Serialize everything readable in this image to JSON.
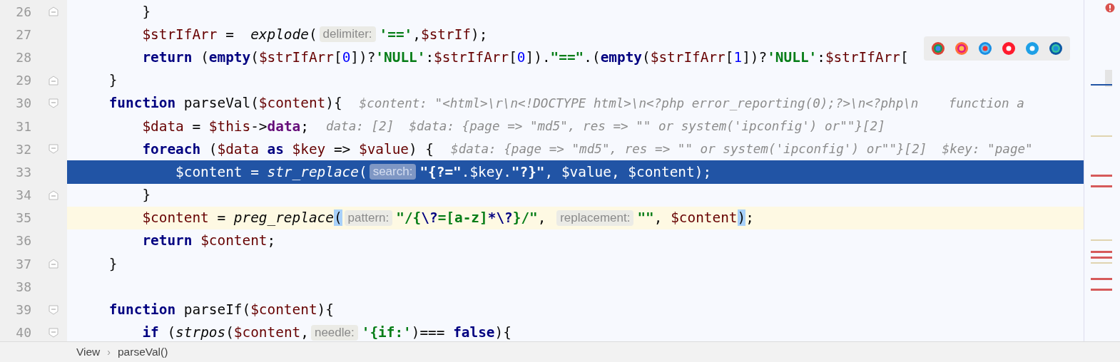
{
  "editor": {
    "lines": [
      {
        "number": "26",
        "kind": "fold-end",
        "selected": false,
        "current": false,
        "tokens": [
          {
            "kind": "plain",
            "text": "        }"
          }
        ]
      },
      {
        "number": "27",
        "kind": "plain",
        "selected": false,
        "current": false,
        "tokens": [
          {
            "kind": "var",
            "text": "        $strIfArr"
          },
          {
            "kind": "plain",
            "text": " =  "
          },
          {
            "kind": "fn",
            "text": "explode"
          },
          {
            "kind": "plain",
            "text": "("
          },
          {
            "kind": "hint",
            "text": "delimiter:"
          },
          {
            "kind": "str",
            "text": "'=='"
          },
          {
            "kind": "plain",
            "text": ","
          },
          {
            "kind": "var",
            "text": "$strIf"
          },
          {
            "kind": "plain",
            "text": ");"
          }
        ]
      },
      {
        "number": "28",
        "kind": "plain",
        "selected": false,
        "current": false,
        "tokens": [
          {
            "kind": "kw",
            "text": "        return"
          },
          {
            "kind": "plain",
            "text": " ("
          },
          {
            "kind": "kw",
            "text": "empty"
          },
          {
            "kind": "plain",
            "text": "("
          },
          {
            "kind": "var",
            "text": "$strIfArr"
          },
          {
            "kind": "plain",
            "text": "["
          },
          {
            "kind": "num",
            "text": "0"
          },
          {
            "kind": "plain",
            "text": "])?"
          },
          {
            "kind": "str",
            "text": "'NULL'"
          },
          {
            "kind": "plain",
            "text": ":"
          },
          {
            "kind": "var",
            "text": "$strIfArr"
          },
          {
            "kind": "plain",
            "text": "["
          },
          {
            "kind": "num",
            "text": "0"
          },
          {
            "kind": "plain",
            "text": "])."
          },
          {
            "kind": "str",
            "text": "\"==\""
          },
          {
            "kind": "plain",
            "text": ".("
          },
          {
            "kind": "kw",
            "text": "empty"
          },
          {
            "kind": "plain",
            "text": "("
          },
          {
            "kind": "var",
            "text": "$strIfArr"
          },
          {
            "kind": "plain",
            "text": "["
          },
          {
            "kind": "num",
            "text": "1"
          },
          {
            "kind": "plain",
            "text": "])?"
          },
          {
            "kind": "str",
            "text": "'NULL'"
          },
          {
            "kind": "plain",
            "text": ":"
          },
          {
            "kind": "var",
            "text": "$strIfArr"
          },
          {
            "kind": "plain",
            "text": "["
          }
        ]
      },
      {
        "number": "29",
        "kind": "fold-end",
        "selected": false,
        "current": false,
        "tokens": [
          {
            "kind": "plain",
            "text": "    }"
          }
        ]
      },
      {
        "number": "30",
        "kind": "fold-start",
        "selected": false,
        "current": false,
        "tokens": [
          {
            "kind": "kw",
            "text": "    function"
          },
          {
            "kind": "plain",
            "text": " parseVal("
          },
          {
            "kind": "var",
            "text": "$content"
          },
          {
            "kind": "plain",
            "text": "){"
          },
          {
            "kind": "debug",
            "text": "$content: \"<html>\\r\\n<!DOCTYPE html>\\n<?php error_reporting(0);?>\\n<?php\\n    function a"
          }
        ]
      },
      {
        "number": "31",
        "kind": "plain",
        "selected": false,
        "current": false,
        "tokens": [
          {
            "kind": "var",
            "text": "        $data"
          },
          {
            "kind": "plain",
            "text": " = "
          },
          {
            "kind": "var",
            "text": "$this"
          },
          {
            "kind": "plain",
            "text": "->"
          },
          {
            "kind": "field",
            "text": "data"
          },
          {
            "kind": "plain",
            "text": ";"
          },
          {
            "kind": "debug",
            "text": "data: [2]  $data: {page => \"md5\", res => \"\" or system('ipconfig') or\"\"}[2]"
          }
        ]
      },
      {
        "number": "32",
        "kind": "fold-start",
        "selected": false,
        "current": false,
        "tokens": [
          {
            "kind": "kw",
            "text": "        foreach"
          },
          {
            "kind": "plain",
            "text": " ("
          },
          {
            "kind": "var",
            "text": "$data"
          },
          {
            "kind": "kw",
            "text": " as "
          },
          {
            "kind": "var",
            "text": "$key"
          },
          {
            "kind": "plain",
            "text": " => "
          },
          {
            "kind": "var",
            "text": "$value"
          },
          {
            "kind": "plain",
            "text": ") {"
          },
          {
            "kind": "debug",
            "text": "$data: {page => \"md5\", res => \"\" or system('ipconfig') or\"\"}[2]  $key: \"page\""
          }
        ]
      },
      {
        "number": "33",
        "kind": "plain",
        "selected": true,
        "current": false,
        "tokens": [
          {
            "kind": "var",
            "text": "            $content"
          },
          {
            "kind": "plain",
            "text": " = "
          },
          {
            "kind": "fn",
            "text": "str_replace"
          },
          {
            "kind": "plain",
            "text": "("
          },
          {
            "kind": "hint",
            "text": "search:"
          },
          {
            "kind": "str",
            "text": "\"{?=\""
          },
          {
            "kind": "plain",
            "text": "."
          },
          {
            "kind": "var",
            "text": "$key"
          },
          {
            "kind": "plain",
            "text": "."
          },
          {
            "kind": "str",
            "text": "\"?}\""
          },
          {
            "kind": "plain",
            "text": ", "
          },
          {
            "kind": "var",
            "text": "$value"
          },
          {
            "kind": "plain",
            "text": ", "
          },
          {
            "kind": "var",
            "text": "$content"
          },
          {
            "kind": "plain",
            "text": ");"
          }
        ]
      },
      {
        "number": "34",
        "kind": "fold-end",
        "selected": false,
        "current": false,
        "tokens": [
          {
            "kind": "plain",
            "text": "        }"
          }
        ]
      },
      {
        "number": "35",
        "kind": "plain",
        "selected": false,
        "current": true,
        "tokens": [
          {
            "kind": "var",
            "text": "        $content"
          },
          {
            "kind": "plain",
            "text": " = "
          },
          {
            "kind": "fn",
            "text": "preg_replace"
          },
          {
            "kind": "match",
            "text": "("
          },
          {
            "kind": "hint",
            "text": "pattern:"
          },
          {
            "kind": "str",
            "text": "\"/{"
          },
          {
            "kind": "esc",
            "text": "\\?"
          },
          {
            "kind": "str",
            "text": "=[a-z]"
          },
          {
            "kind": "esc",
            "text": "*\\?"
          },
          {
            "kind": "str",
            "text": "}/\""
          },
          {
            "kind": "plain",
            "text": ", "
          },
          {
            "kind": "hint",
            "text": "replacement:"
          },
          {
            "kind": "str",
            "text": "\"\""
          },
          {
            "kind": "plain",
            "text": ", "
          },
          {
            "kind": "var",
            "text": "$content"
          },
          {
            "kind": "match",
            "text": ")"
          },
          {
            "kind": "plain",
            "text": ";"
          }
        ]
      },
      {
        "number": "36",
        "kind": "plain",
        "selected": false,
        "current": false,
        "tokens": [
          {
            "kind": "kw",
            "text": "        return"
          },
          {
            "kind": "var",
            "text": " $content"
          },
          {
            "kind": "plain",
            "text": ";"
          }
        ]
      },
      {
        "number": "37",
        "kind": "fold-end",
        "selected": false,
        "current": false,
        "tokens": [
          {
            "kind": "plain",
            "text": "    }"
          }
        ]
      },
      {
        "number": "38",
        "kind": "plain",
        "selected": false,
        "current": false
      },
      {
        "number": "39",
        "kind": "fold-start",
        "selected": false,
        "current": false,
        "tokens": [
          {
            "kind": "kw",
            "text": "    function"
          },
          {
            "kind": "plain",
            "text": " parseIf("
          },
          {
            "kind": "var",
            "text": "$content"
          },
          {
            "kind": "plain",
            "text": "){"
          }
        ]
      },
      {
        "number": "40",
        "kind": "fold-start",
        "selected": false,
        "current": false,
        "tokens": [
          {
            "kind": "kw",
            "text": "        if"
          },
          {
            "kind": "plain",
            "text": " ("
          },
          {
            "kind": "fn",
            "text": "strpos"
          },
          {
            "kind": "plain",
            "text": "("
          },
          {
            "kind": "var",
            "text": "$content"
          },
          {
            "kind": "plain",
            "text": ","
          },
          {
            "kind": "hint",
            "text": "needle:"
          },
          {
            "kind": "str",
            "text": "'{if:'"
          },
          {
            "kind": "plain",
            "text": ")=== "
          },
          {
            "kind": "kw",
            "text": "false"
          },
          {
            "kind": "plain",
            "text": "){"
          }
        ]
      }
    ]
  },
  "breadcrumbs": [
    "View",
    "parseVal()"
  ],
  "breadcrumb_separator": "›"
}
